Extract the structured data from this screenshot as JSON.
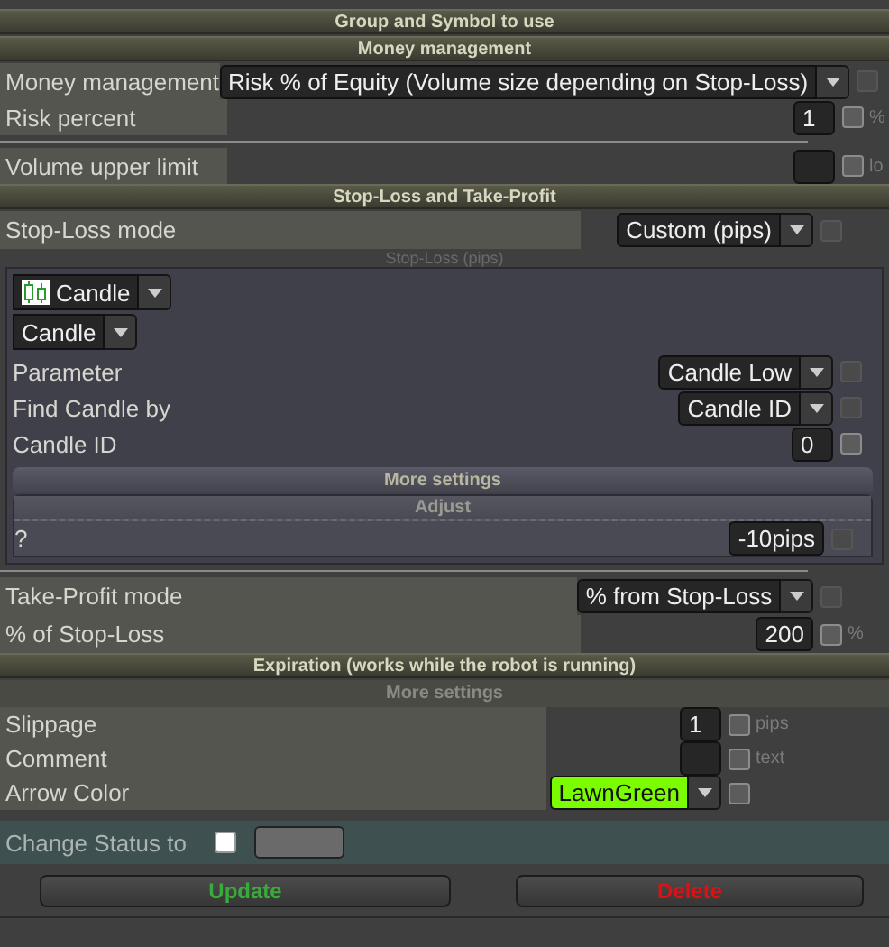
{
  "items": [
    {
      "kind": "section",
      "title": "Group and Symbol to use"
    },
    {
      "kind": "section",
      "title": "Money management"
    },
    {
      "kind": "rows-narrow",
      "rows": [
        {
          "label": "Money management",
          "control": {
            "kind": "select",
            "value": "Risk % of Equity (Volume size depending on Stop-Loss)"
          },
          "checkbox": {
            "checked": false,
            "disabled": true
          }
        },
        {
          "label": "Risk percent",
          "control": {
            "kind": "number",
            "value": "1"
          },
          "checkbox": {
            "checked": false,
            "disabled": false
          },
          "unit": "%"
        }
      ]
    },
    {
      "kind": "divider"
    },
    {
      "kind": "rows-narrow",
      "rows": [
        {
          "label": "Volume upper limit",
          "control": {
            "kind": "number"
          },
          "checkbox": {
            "checked": false,
            "disabled": false
          },
          "unit": "lo"
        }
      ]
    },
    {
      "kind": "section",
      "title": "Stop-Loss and Take-Profit"
    },
    {
      "kind": "rows-wide",
      "rows": [
        {
          "label": "Stop-Loss mode",
          "control": {
            "kind": "select",
            "value": "Custom (pips)"
          },
          "checkbox": {
            "checked": false,
            "disabled": true
          }
        }
      ]
    },
    {
      "kind": "caption",
      "title": "Stop-Loss (pips)"
    },
    {
      "kind": "panel",
      "items": [
        {
          "kind": "indicator-picker",
          "value": "Candle"
        },
        {
          "kind": "picker",
          "value": "Candle"
        },
        {
          "kind": "rows-plain",
          "rows": [
            {
              "label": "Parameter",
              "control": {
                "kind": "select",
                "value": "Candle Low"
              },
              "checkbox": {
                "checked": false,
                "disabled": true
              }
            },
            {
              "label": "Find Candle by",
              "control": {
                "kind": "select",
                "value": "Candle ID"
              },
              "checkbox": {
                "checked": false,
                "disabled": true
              }
            },
            {
              "label": "Candle ID",
              "control": {
                "kind": "number",
                "value": "0"
              },
              "checkbox": {
                "checked": false,
                "disabled": false
              }
            }
          ]
        },
        {
          "kind": "bar",
          "title": "More settings"
        },
        {
          "kind": "box",
          "title": "Adjust",
          "rows": [
            {
              "label": "?",
              "control": {
                "kind": "number",
                "value": "-10pips"
              },
              "checkbox": {
                "checked": false,
                "disabled": true
              }
            }
          ]
        }
      ]
    },
    {
      "kind": "divider"
    },
    {
      "kind": "rows-wide",
      "rows": [
        {
          "label": "Take-Profit mode",
          "control": {
            "kind": "select",
            "value": "% from Stop-Loss"
          },
          "checkbox": {
            "checked": false,
            "disabled": true
          }
        },
        {
          "label": "% of Stop-Loss",
          "control": {
            "kind": "number",
            "value": "200"
          },
          "checkbox": {
            "checked": false,
            "disabled": false
          },
          "unit": "%"
        }
      ]
    },
    {
      "kind": "section",
      "title": "Expiration (works while the robot is running)"
    },
    {
      "kind": "subsection",
      "title": "More settings"
    },
    {
      "kind": "rows-half",
      "rows": [
        {
          "label": "Slippage",
          "control": {
            "kind": "number",
            "value": "1"
          },
          "checkbox": {
            "checked": false,
            "disabled": false
          },
          "unit": "pips"
        },
        {
          "label": "Comment",
          "control": {
            "kind": "number"
          },
          "checkbox": {
            "checked": false,
            "disabled": false
          },
          "unit": "text"
        },
        {
          "label": "Arrow Color",
          "control": {
            "kind": "color-select",
            "value": "LawnGreen",
            "color": "#7cfc00"
          },
          "checkbox": {
            "checked": false,
            "disabled": false
          }
        }
      ]
    }
  ],
  "status": {
    "label": "Change Status to",
    "checkbox": {
      "checked": false
    }
  },
  "buttons": [
    {
      "label": "Update",
      "kind": "confirm"
    },
    {
      "label": "Delete",
      "kind": "danger"
    }
  ]
}
